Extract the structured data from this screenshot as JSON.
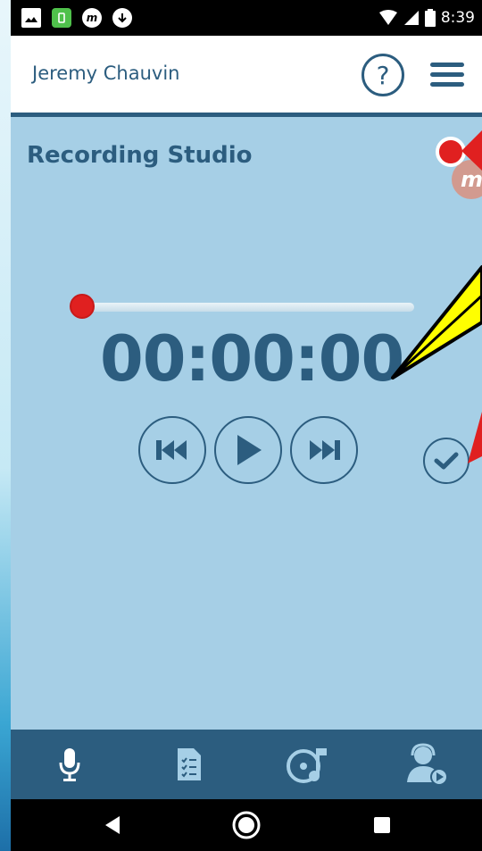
{
  "status_bar": {
    "time": "8:39",
    "left_icons": [
      "image-icon",
      "phone-app-icon",
      "m-app-icon",
      "download-icon"
    ],
    "right_icons": [
      "wifi-icon",
      "signal-icon",
      "battery-icon"
    ]
  },
  "header": {
    "user_name": "Jeremy Chauvin",
    "help_label": "?",
    "menu_icon": "hamburger-menu-icon"
  },
  "main": {
    "title": "Recording Studio",
    "badge_letter": "m",
    "timer": "00:00:00",
    "progress": 0,
    "controls": [
      "skip-back-icon",
      "play-icon",
      "skip-forward-icon",
      "check-icon"
    ]
  },
  "bottom_nav": {
    "items": [
      "microphone-icon",
      "checklist-icon",
      "music-disc-icon",
      "agent-play-icon"
    ]
  },
  "system_nav": {
    "items": [
      "back-triangle-icon",
      "home-circle-icon",
      "recents-square-icon"
    ]
  },
  "colors": {
    "primary": "#2c5d7f",
    "panel": "#a6cfe6",
    "record_red": "#e02020",
    "annotation_yellow": "#ffff00"
  }
}
